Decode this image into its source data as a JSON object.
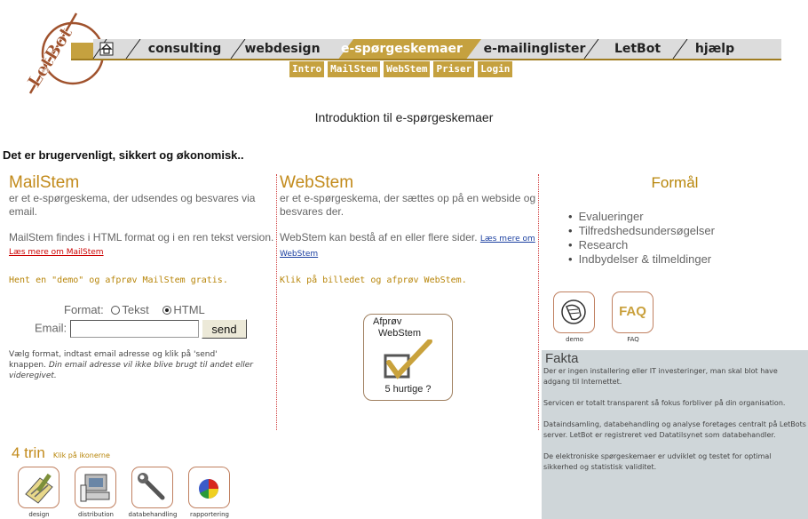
{
  "logo": {
    "text": "LetBot"
  },
  "nav": {
    "tabs": [
      {
        "label": "consulting"
      },
      {
        "label": "webdesign"
      },
      {
        "label": "e-spørgeskemaer",
        "active": true
      },
      {
        "label": "e-mailinglister"
      },
      {
        "label": "LetBot"
      },
      {
        "label": "hjælp"
      }
    ],
    "home_icon": "home-icon",
    "subnav": [
      "Intro",
      "MailStem",
      "WebStem",
      "Priser",
      "Login"
    ]
  },
  "page": {
    "title": "Introduktion til e-spørgeskemaer",
    "intro": "Det er brugervenligt, sikkert og økonomisk.."
  },
  "mailstem": {
    "heading": "MailStem",
    "desc": "er et e-spørgeskema, der udsendes og besvares via email.",
    "formats_text": "MailStem findes i HTML format og i en ren tekst version.",
    "link": "Læs mere om MailStem",
    "demo_text": "Hent en \"demo\" og afprøv MailStem gratis.",
    "format_label": "Format:",
    "opt_text": "Tekst",
    "opt_html": "HTML",
    "email_label": "Email:",
    "email_value": "",
    "send": "send",
    "help": "Vælg format, indtast email adresse og klik på 'send' knappen.",
    "help_em": "Din email adresse vil ikke blive brugt til andet eller videregivet."
  },
  "steps": {
    "heading": "4 trin",
    "hint": "Klik på ikonerne",
    "items": [
      {
        "label": "design",
        "icon": "design-icon"
      },
      {
        "label": "distribution",
        "icon": "distribution-icon"
      },
      {
        "label": "databehandling",
        "icon": "wrench-icon"
      },
      {
        "label": "rapportering",
        "icon": "pie-chart-icon"
      }
    ]
  },
  "webstem": {
    "heading": "WebStem",
    "desc": "er et e-spørgeskema, der sættes op på en webside og besvares der.",
    "pages_text": "WebStem kan bestå af en eller flere sider.",
    "link": "Læs mere om WebStem",
    "click_text": "Klik på billedet og afprøv WebStem.",
    "demo_top": "Afprøv",
    "demo_mid": "WebStem",
    "demo_bottom": "5 hurtige ?"
  },
  "formaal": {
    "title": "Formål",
    "items": [
      "Evalueringer",
      "Tilfredshedsundersøgelser",
      "Research",
      "Indbydelser & tilmeldinger"
    ],
    "demo_label": "demo",
    "faq_label": "FAQ",
    "faq_icon_text": "FAQ"
  },
  "fakta": {
    "title": "Fakta",
    "paras": [
      "Der er ingen installering eller IT investeringer, man skal blot have adgang til Internettet.",
      "Servicen er totalt transparent så fokus forbliver på din organisation.",
      "Dataindsamling, databehandling og analyse foretages centralt på LetBots server. LetBot er registreret ved Datatilsynet som databehandler.",
      "De elektroniske spørgeskemaer er udviklet og testet for optimal sikkerhed og statistisk validitet."
    ]
  },
  "colors": {
    "accent": "#c5a13f",
    "heading": "#c28a1a",
    "link_red": "#cc0000",
    "link_blue": "#1a3fa0",
    "fakta_bg": "#cfd6d9"
  }
}
